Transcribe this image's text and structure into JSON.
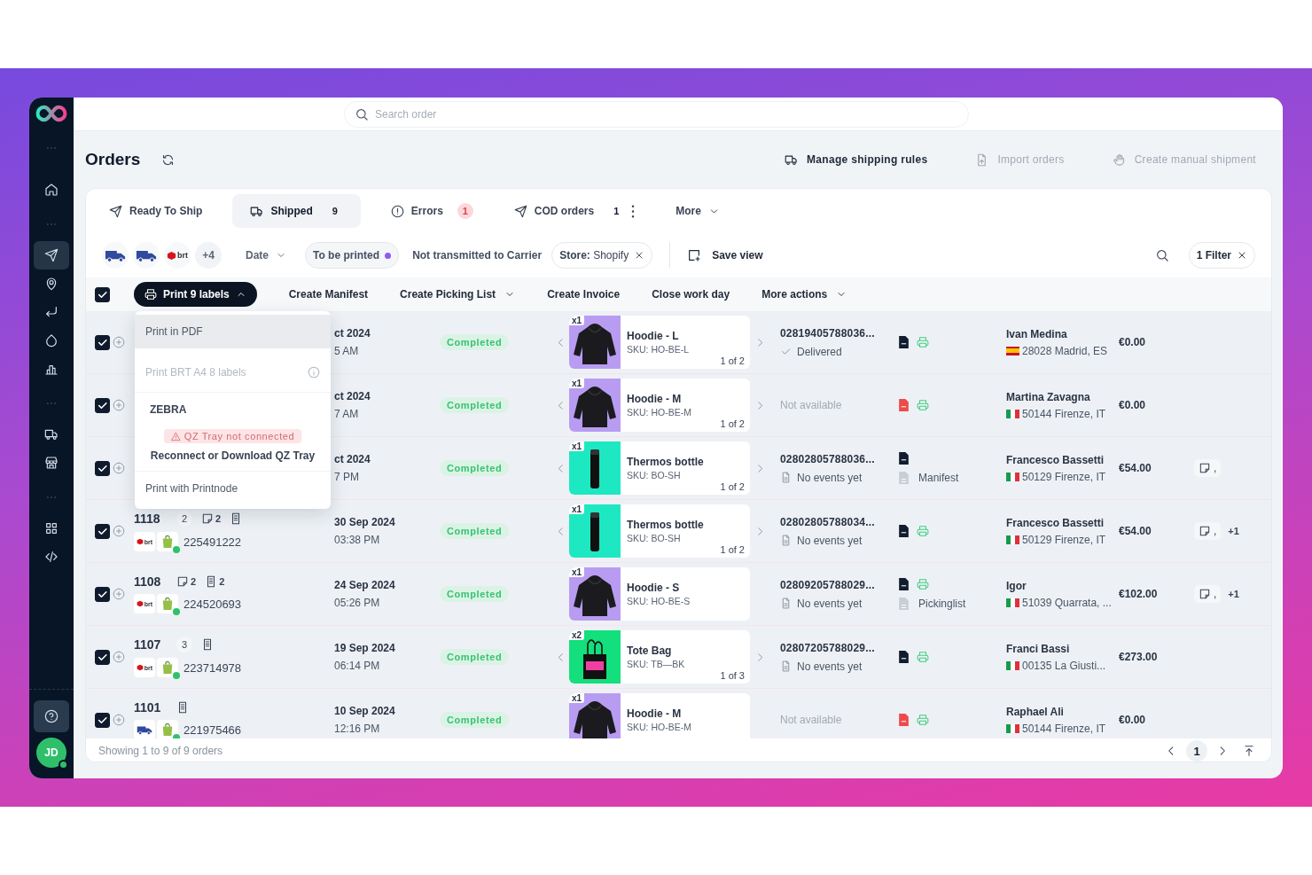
{
  "sidebar": {
    "groups": [
      {
        "items": [
          {
            "kind": "home",
            "selected": false
          }
        ]
      },
      {
        "items": [
          {
            "kind": "send",
            "selected": true
          },
          {
            "kind": "pin",
            "selected": false
          },
          {
            "kind": "return",
            "selected": false
          },
          {
            "kind": "drop",
            "selected": false
          },
          {
            "kind": "chart",
            "selected": false
          }
        ]
      },
      {
        "items": [
          {
            "kind": "truck",
            "selected": false
          },
          {
            "kind": "store",
            "selected": false
          }
        ]
      },
      {
        "items": [
          {
            "kind": "grid",
            "selected": false
          },
          {
            "kind": "code",
            "selected": false
          }
        ]
      }
    ],
    "avatar": {
      "initials": "JD",
      "online": true
    }
  },
  "search": {
    "placeholder": "Search order"
  },
  "header": {
    "title": "Orders",
    "actions": [
      {
        "kind": "truck",
        "label": "Manage shipping rules",
        "disabled": false
      },
      {
        "kind": "file-up",
        "label": "Import orders",
        "disabled": true
      },
      {
        "kind": "hand",
        "label": "Create manual shipment",
        "disabled": true
      }
    ]
  },
  "tabs": [
    {
      "kind": "send",
      "label": "Ready To Ship",
      "selected": false
    },
    {
      "kind": "truck",
      "label": "Shipped",
      "count": {
        "text": "9",
        "kind": "plain"
      },
      "selected": true
    },
    {
      "kind": "alert",
      "label": "Errors",
      "count": {
        "text": "1",
        "kind": "alert"
      },
      "selected": false
    },
    {
      "kind": "send",
      "label": "COD orders",
      "count": {
        "text": "1",
        "kind": "plain"
      },
      "menu": true,
      "selected": false
    },
    {
      "label": "More",
      "dropdown": true,
      "selected": false
    }
  ],
  "filters": {
    "carriers": [
      {
        "kind": "van"
      },
      {
        "kind": "van"
      },
      {
        "kind": "brt",
        "label": "brt"
      }
    ],
    "more_carriers": "+4",
    "chips": [
      {
        "kind": "dropdown",
        "label": "Date"
      },
      {
        "kind": "chip",
        "label": "To be printed",
        "color": "#8b5cf6"
      },
      {
        "kind": "plain",
        "label": "Not transmitted to Carrier"
      },
      {
        "kind": "removable",
        "label": "**Store:** Shopify"
      }
    ],
    "save_view": "Save view",
    "active_filters": "1 Filter"
  },
  "actions": {
    "select_all": true,
    "print": {
      "label": "Print 9 labels",
      "expanded": true
    },
    "items": [
      {
        "label": "Create Manifest",
        "dropdown": false
      },
      {
        "label": "Create Picking List",
        "dropdown": true
      },
      {
        "label": "Create Invoice",
        "dropdown": false
      },
      {
        "label": "Close work day",
        "dropdown": false
      },
      {
        "label": "More actions",
        "dropdown": true
      }
    ]
  },
  "print_menu": {
    "items": [
      {
        "kind": "item",
        "label": "Print in PDF",
        "highlighted": true,
        "disabled": false
      },
      {
        "kind": "item",
        "label": "Print BRT A4 8 labels",
        "highlighted": false,
        "disabled": true,
        "info": true
      },
      {
        "kind": "section",
        "title": "ZEBRA",
        "warning": "QZ Tray not connected",
        "action": "Reconnect or Download QZ Tray"
      },
      {
        "kind": "item",
        "label": "Print with Printnode",
        "highlighted": false,
        "disabled": false
      }
    ]
  },
  "rows": [
    {
      "selected": true,
      "date": "ct 2024",
      "time": "5 AM",
      "status": {
        "kind": "completed",
        "label": "Completed"
      },
      "product": {
        "kind": "hoodie",
        "qty": "x1",
        "name": "Hoodie - L",
        "sku": "SKU: HO-BE-L",
        "pager": "1 of 2"
      },
      "tracking": {
        "kind": "number",
        "number": "02819405788036...",
        "event": {
          "kind": "delivered",
          "text": "Delivered"
        }
      },
      "labels": [
        {
          "kind": "zpl"
        }
      ],
      "printable": true,
      "customer": {
        "name": "Ivan Medina",
        "flag": {
          "kind": "es"
        },
        "address": "28028 Madrid, ES"
      },
      "amount": "€0.00"
    },
    {
      "selected": true,
      "date": "ct 2024",
      "time": "7 AM",
      "status": {
        "kind": "completed",
        "label": "Completed"
      },
      "product": {
        "kind": "hoodie",
        "qty": "x1",
        "name": "Hoodie - M",
        "sku": "SKU: HO-BE-M",
        "pager": "1 of 2"
      },
      "tracking": {
        "kind": "none",
        "text": "Not available"
      },
      "labels": [
        {
          "kind": "pdf"
        }
      ],
      "printable": true,
      "customer": {
        "name": "Martina Zavagna",
        "flag": {
          "kind": "it"
        },
        "address": "50144 Firenze, IT"
      },
      "amount": "€0.00"
    },
    {
      "selected": true,
      "date": "ct 2024",
      "time": "7 PM",
      "status": {
        "kind": "completed",
        "label": "Completed"
      },
      "product": {
        "kind": "bottle",
        "qty": "x1",
        "name": "Thermos bottle",
        "sku": "SKU: BO-SH",
        "pager": "1 of 2"
      },
      "tracking": {
        "kind": "number",
        "number": "02802805788036...",
        "event": {
          "kind": "none",
          "text": "No events yet"
        }
      },
      "labels": [
        {
          "kind": "zpl"
        }
      ],
      "printable": false,
      "document": {
        "label": "Manifest"
      },
      "customer": {
        "name": "Francesco Bassetti",
        "flag": {
          "kind": "it"
        },
        "address": "50129 Firenze, IT"
      },
      "amount": "€54.00",
      "notes": {
        "sep": ","
      }
    },
    {
      "selected": true,
      "order": {
        "id": "1118",
        "badges": [
          {
            "kind": "count",
            "text": "2"
          },
          {
            "kind": "note",
            "text": "2"
          },
          {
            "kind": "doc"
          }
        ],
        "carrier": {
          "kind": "brt",
          "label": "brt"
        },
        "store": {
          "connected": true
        },
        "number": "225491222"
      },
      "date": "30 Sep 2024",
      "time": "03:38 PM",
      "status": {
        "kind": "completed",
        "label": "Completed"
      },
      "product": {
        "kind": "bottle",
        "qty": "x1",
        "name": "Thermos bottle",
        "sku": "SKU: BO-SH",
        "pager": "1 of 2"
      },
      "tracking": {
        "kind": "number",
        "number": "02802805788034...",
        "event": {
          "kind": "none",
          "text": "No events yet"
        }
      },
      "labels": [
        {
          "kind": "zpl"
        }
      ],
      "printable": true,
      "customer": {
        "name": "Francesco Bassetti",
        "flag": {
          "kind": "it"
        },
        "address": "50129 Firenze, IT"
      },
      "amount": "€54.00",
      "notes": {
        "sep": ",",
        "more": "+1"
      }
    },
    {
      "selected": true,
      "order": {
        "id": "1108",
        "badges": [
          {
            "kind": "note",
            "text": "2"
          },
          {
            "kind": "doc",
            "text": "2"
          }
        ],
        "carrier": {
          "kind": "brt",
          "label": "brt"
        },
        "store": {
          "connected": true
        },
        "number": "224520693"
      },
      "date": "24 Sep 2024",
      "time": "05:26 PM",
      "status": {
        "kind": "completed",
        "label": "Completed"
      },
      "product": {
        "kind": "hoodie",
        "qty": "x1",
        "name": "Hoodie - S",
        "sku": "SKU: HO-BE-S"
      },
      "tracking": {
        "kind": "number",
        "number": "02809205788029...",
        "event": {
          "kind": "none",
          "text": "No events yet"
        }
      },
      "labels": [
        {
          "kind": "zpl"
        }
      ],
      "printable": true,
      "document": {
        "label": "Pickinglist"
      },
      "customer": {
        "name": "Igor",
        "flag": {
          "kind": "it"
        },
        "address": "51039 Quarrata, ..."
      },
      "amount": "€102.00",
      "notes": {
        "sep": ",",
        "more": "+1"
      }
    },
    {
      "selected": true,
      "order": {
        "id": "1107",
        "badges": [
          {
            "kind": "count",
            "text": "3"
          },
          {
            "kind": "doc"
          }
        ],
        "carrier": {
          "kind": "brt",
          "label": "brt"
        },
        "store": {
          "connected": true
        },
        "number": "223714978"
      },
      "date": "19 Sep 2024",
      "time": "06:14 PM",
      "status": {
        "kind": "completed",
        "label": "Completed"
      },
      "product": {
        "kind": "tote",
        "qty": "x2",
        "name": "Tote Bag",
        "sku": "SKU: TB—BK",
        "pager": "1 of 3"
      },
      "tracking": {
        "kind": "number",
        "number": "02807205788029...",
        "event": {
          "kind": "none",
          "text": "No events yet"
        }
      },
      "labels": [
        {
          "kind": "zpl"
        }
      ],
      "printable": true,
      "customer": {
        "name": "Franci Bassi",
        "flag": {
          "kind": "it"
        },
        "address": "00135 La Giusti..."
      },
      "amount": "€273.00"
    },
    {
      "selected": true,
      "order": {
        "id": "1101",
        "badges": [
          {
            "kind": "doc"
          }
        ],
        "carrier": {
          "kind": "van"
        },
        "store": {
          "connected": true
        },
        "number": "221975466"
      },
      "date": "10 Sep 2024",
      "time": "12:16 PM",
      "status": {
        "kind": "completed",
        "label": "Completed"
      },
      "product": {
        "kind": "hoodie",
        "qty": "x1",
        "name": "Hoodie - M",
        "sku": "SKU: HO-BE-M"
      },
      "tracking": {
        "kind": "none",
        "text": "Not available"
      },
      "labels": [
        {
          "kind": "pdf"
        }
      ],
      "printable": true,
      "customer": {
        "name": "Raphael Ali",
        "flag": {
          "kind": "it"
        },
        "address": "50144 Firenze, IT"
      },
      "amount": "€0.00"
    }
  ],
  "footer": {
    "summary": "Showing 1 to 9 of 9 orders",
    "pages": [
      {
        "label": "1",
        "selected": true
      }
    ]
  }
}
